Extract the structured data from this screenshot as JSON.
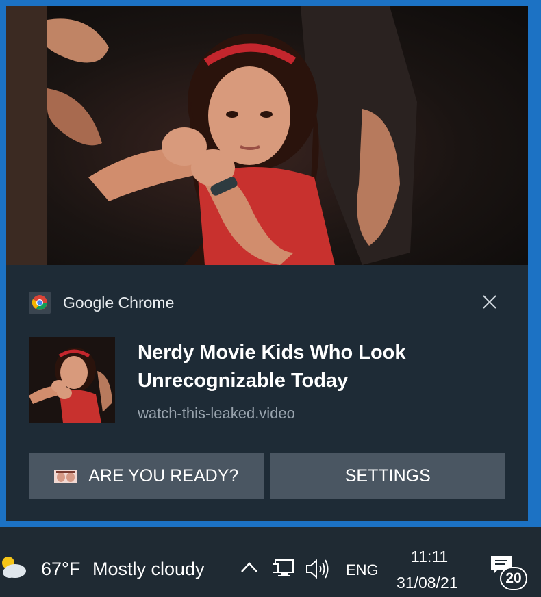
{
  "notification": {
    "app_name": "Google Chrome",
    "app_icon": "chrome-icon",
    "close_icon": "close-icon",
    "title": "Nerdy Movie Kids Who Look Unrecognizable Today",
    "source": "watch-this-leaked.video",
    "actions": [
      {
        "label": "ARE YOU READY?",
        "icon": "emoji-thumbnail-icon"
      },
      {
        "label": "SETTINGS"
      }
    ],
    "colors": {
      "frame": "#1c72c4",
      "background": "#1e2b36",
      "button": "#4a5662"
    }
  },
  "taskbar": {
    "weather": {
      "icon": "partly-cloudy-icon",
      "temperature": "67°F",
      "condition": "Mostly cloudy"
    },
    "tray": {
      "chevron_icon": "chevron-up-icon",
      "network_icon": "network-icon",
      "volume_icon": "volume-icon"
    },
    "language": "ENG",
    "time": "11:11",
    "date": "31/08/21",
    "notification_center": {
      "icon": "action-center-icon",
      "count": "20"
    }
  }
}
